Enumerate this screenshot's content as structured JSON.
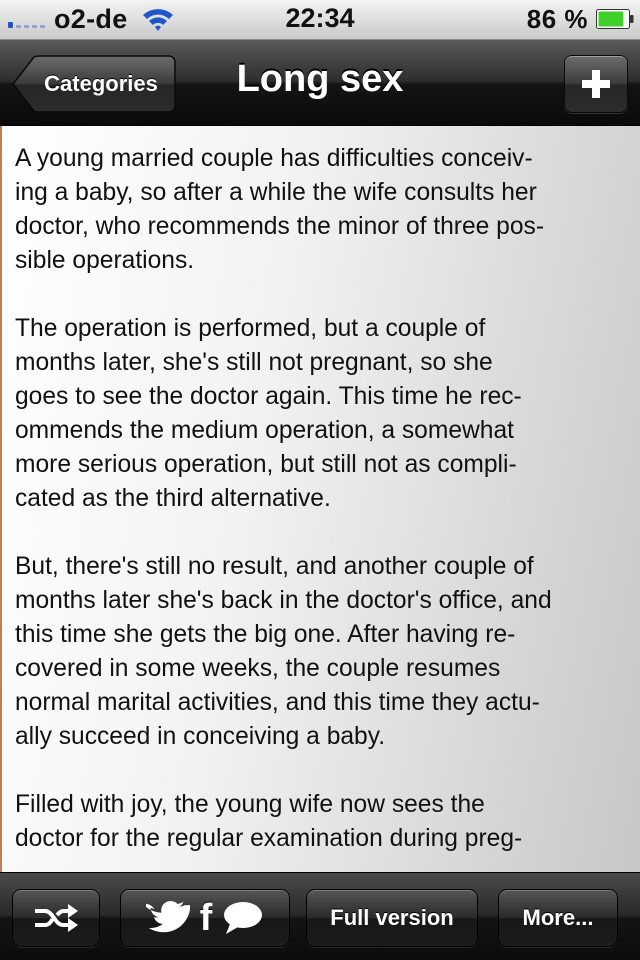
{
  "status_bar": {
    "carrier": "o2-de",
    "time": "22:34",
    "battery": "86 %",
    "battery_level": 0.86,
    "signal_bars": 1,
    "icons": [
      "signal-icon",
      "wifi-icon",
      "battery-icon"
    ]
  },
  "nav": {
    "back_label": "Categories",
    "title": "Long sex",
    "add_icon": "plus-icon"
  },
  "content": {
    "paragraphs": [
      "A young married couple has difficulties conceiv-\ning a baby, so after a while the wife consults her\ndoctor, who recommends the minor of three pos-\nsible operations.",
      "The operation is performed, but a couple of\nmonths later, she's still not pregnant, so she\ngoes to see the doctor again. This time he rec-\nommends the medium operation, a somewhat\nmore serious operation, but still not as compli-\ncated as the third alternative.",
      "But, there's still no result, and another couple of\nmonths later she's back in the doctor's office, and\nthis time she gets the big one. After having re-\ncovered in some weeks, the couple resumes\nnormal marital activities, and this time they actu-\nally succeed in conceiving a baby.",
      "Filled with joy, the young wife now sees the\ndoctor for the regular examination during preg-"
    ]
  },
  "toolbar": {
    "shuffle_icon": "shuffle-icon",
    "social_icons": [
      "twitter-icon",
      "facebook-icon",
      "chat-bubble-icon"
    ],
    "facebook_letter": "f",
    "full_version_label": "Full version",
    "more_label": "More..."
  },
  "colors": {
    "signal": "#1f57c9",
    "battery": "#3fd12a",
    "nav_background": "#141414",
    "content_text": "#111111"
  }
}
